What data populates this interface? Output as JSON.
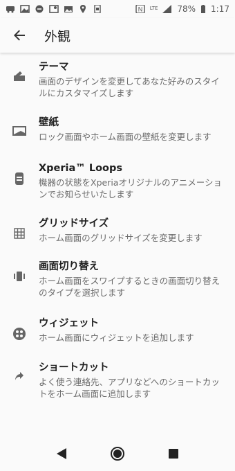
{
  "status_bar": {
    "left_icons": [
      "car-notification-icon",
      "image-notification-icon",
      "dnd-icon",
      "map-icon",
      "photo-icon",
      "location-icon",
      "screenshot-icon"
    ],
    "lte": "LTE",
    "battery": "78%",
    "time": "1:17"
  },
  "header": {
    "title": "外観"
  },
  "items": [
    {
      "icon": "theme-icon",
      "title": "テーマ",
      "desc": "画面のデザインを変更してあなた好みのスタイルにカスタマイズします"
    },
    {
      "icon": "wallpaper-icon",
      "title": "壁紙",
      "desc": "ロック画面やホーム画面の壁紙を変更します"
    },
    {
      "icon": "xperia-loops-icon",
      "title": "Xperia™ Loops",
      "desc": "機器の状態をXperiaオリジナルのアニメーションでお知らせいたします"
    },
    {
      "icon": "grid-icon",
      "title": "グリッドサイズ",
      "desc": "ホーム画面のグリッドサイズを変更します"
    },
    {
      "icon": "screen-switch-icon",
      "title": "画面切り替え",
      "desc": "ホーム画面をスワイプするときの画面切り替えのタイプを選択します"
    },
    {
      "icon": "widget-icon",
      "title": "ウィジェット",
      "desc": "ホーム画面にウィジェットを追加します"
    },
    {
      "icon": "shortcut-icon",
      "title": "ショートカット",
      "desc": "よく使う連絡先、アプリなどへのショートカットをホーム画面に追加します"
    }
  ],
  "nav": {
    "back": "back-nav-icon",
    "home": "home-nav-icon",
    "recents": "recents-nav-icon"
  }
}
